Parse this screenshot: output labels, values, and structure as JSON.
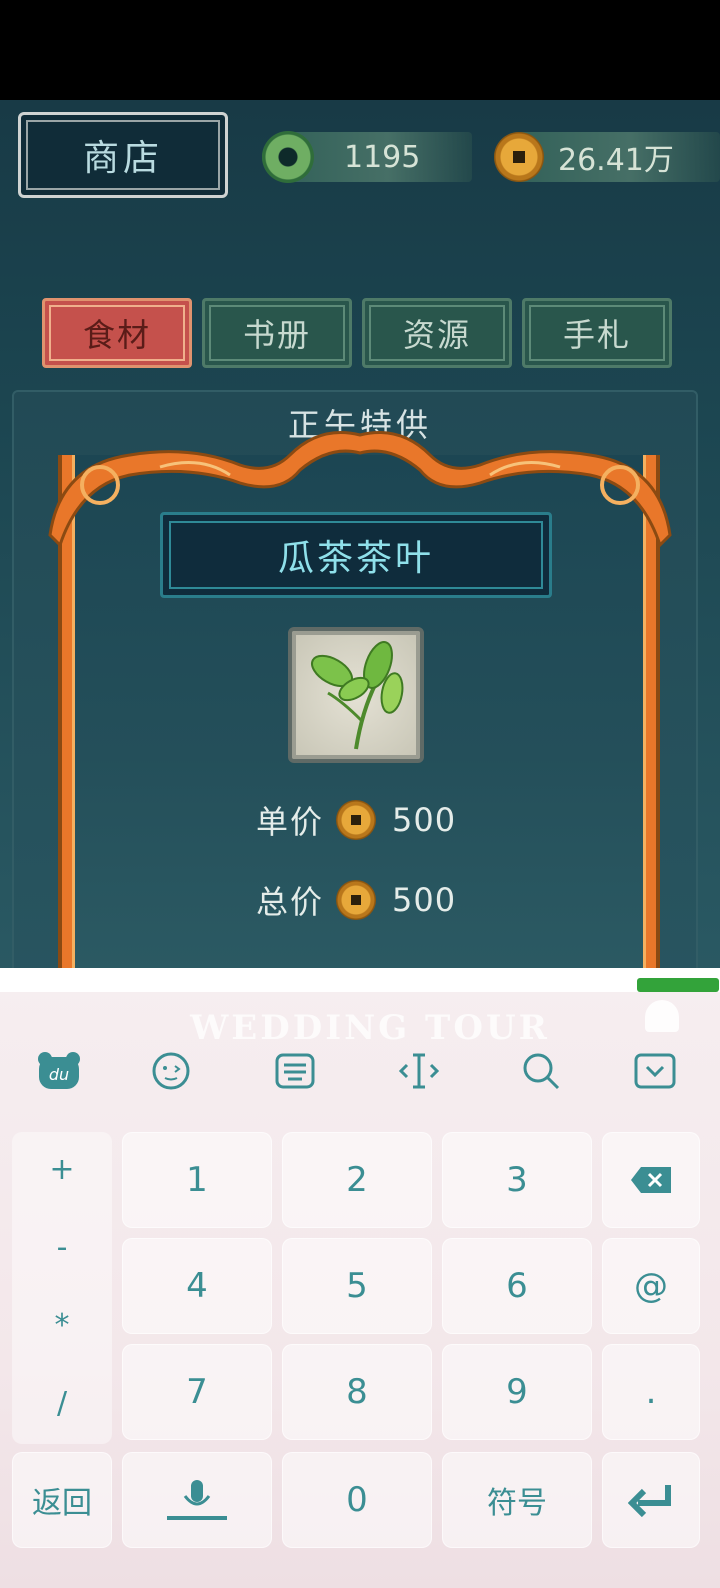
{
  "shop": {
    "title": "商店"
  },
  "currencies": {
    "jade": "1195",
    "coins": "26.41万"
  },
  "tabs": [
    {
      "label": "食材",
      "active": true
    },
    {
      "label": "书册",
      "active": false
    },
    {
      "label": "资源",
      "active": false
    },
    {
      "label": "手札",
      "active": false
    }
  ],
  "panel": {
    "heading": "正午特供"
  },
  "item": {
    "name": "瓜茶茶叶",
    "unit_price_label": "单价",
    "unit_price": "500",
    "total_price_label": "总价",
    "total_price": "500"
  },
  "keyboard": {
    "watermark": "WEDDING TOUR",
    "side_symbols": [
      "+",
      "-",
      "*",
      "/"
    ],
    "keys": {
      "k1": "1",
      "k2": "2",
      "k3": "3",
      "k4": "4",
      "k5": "5",
      "k6": "6",
      "k7": "7",
      "k8": "8",
      "k9": "9",
      "k0": "0",
      "at": "@",
      "dot": ".",
      "back": "返回",
      "symbols": "符号"
    },
    "colors": {
      "accent": "#3b8e93",
      "green_indicator": "#33a33a"
    }
  }
}
